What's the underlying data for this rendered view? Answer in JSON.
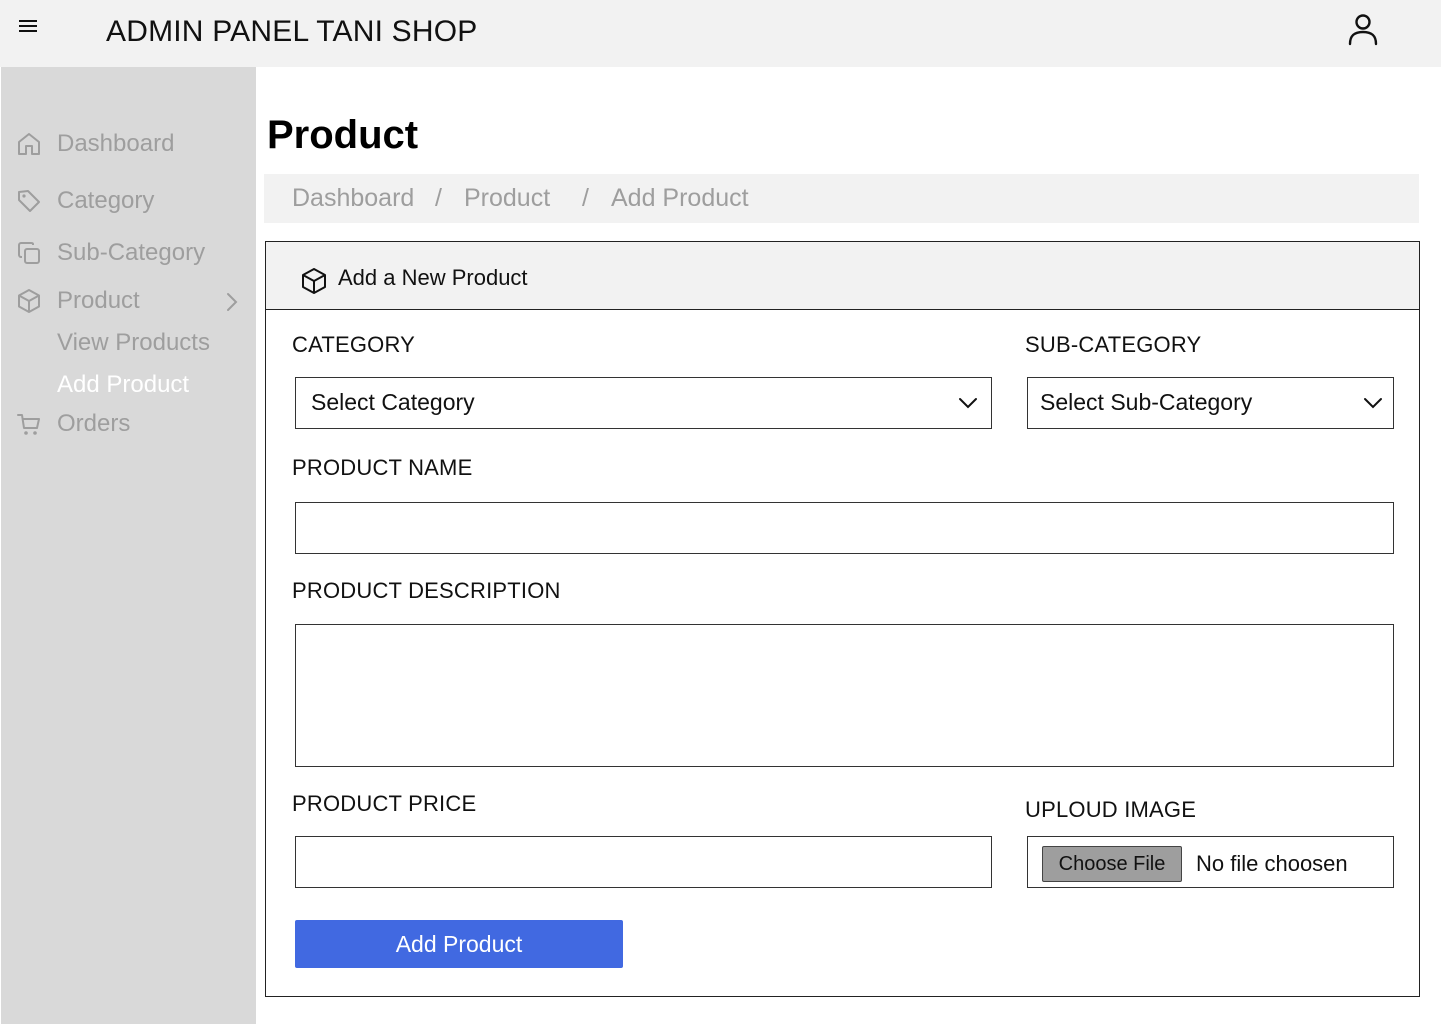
{
  "header": {
    "menu_icon": "hamburger-menu-icon",
    "title": "ADMIN PANEL TANI SHOP",
    "user_icon": "user-icon"
  },
  "sidebar": {
    "items": [
      {
        "label": "Dashboard",
        "icon": "home-icon"
      },
      {
        "label": "Category",
        "icon": "tag-icon"
      },
      {
        "label": "Sub-Category",
        "icon": "copy-icon"
      },
      {
        "label": "Product",
        "icon": "box-icon",
        "expanded": true
      },
      {
        "label": "Orders",
        "icon": "cart-icon"
      }
    ],
    "product_sub_items": [
      {
        "label": "View Products",
        "active": false
      },
      {
        "label": "Add Product",
        "active": true
      }
    ],
    "colors": {
      "background": "#d9d9d9",
      "text": "#9e9e9e",
      "active_text": "#ffffff"
    }
  },
  "main": {
    "page_title": "Product",
    "breadcrumb": {
      "items": [
        "Dashboard",
        "Product",
        "Add Product"
      ],
      "separator": "/"
    },
    "card": {
      "title": "Add a New Product",
      "icon": "box-icon"
    },
    "form": {
      "category": {
        "label": "CATEGORY",
        "selected": "Select Category"
      },
      "sub_category": {
        "label": "SUB-CATEGORY",
        "selected": "Select Sub-Category"
      },
      "product_name": {
        "label": "PRODUCT NAME",
        "value": ""
      },
      "product_description": {
        "label": "PRODUCT DESCRIPTION",
        "value": ""
      },
      "product_price": {
        "label": "PRODUCT PRICE",
        "value": ""
      },
      "upload_image": {
        "label": "UPLOUD IMAGE",
        "button_label": "Choose File",
        "status": "No file choosen"
      },
      "submit_label": "Add Product"
    },
    "colors": {
      "primary_button": "#4169e1",
      "panel_background": "#f2f2f2"
    }
  }
}
